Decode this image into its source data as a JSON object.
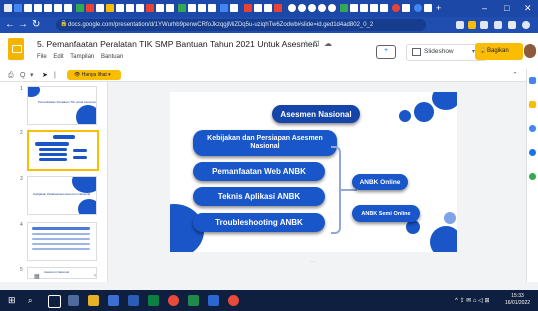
{
  "browser": {
    "url": "docs.google.com/presentation/d/1YWurhb9penwCRfoJkzqgjMiZDq5u-uziqhTw6Zodwb#slide=id.ged1d4ad802_0_2",
    "window_controls": [
      "–",
      "□",
      "✕"
    ],
    "new_tab": "+"
  },
  "header": {
    "title": "5. Pemanfaatan Peralatan TIK SMP Bantuan Tahun 2021 Untuk Asesmen",
    "menus": [
      "File",
      "Edit",
      "Tampilan",
      "Bantuan"
    ],
    "slideshow_label": "Slideshow",
    "share_label": "Bagikan"
  },
  "toolbar": {
    "zoom_label": "Q",
    "hide_menus_label": "Hanya lihat"
  },
  "filmstrip": {
    "slide_numbers": [
      "1",
      "2",
      "3",
      "4",
      "5"
    ],
    "thumb1_title": "Pemanfaatan Peralatan TIK untuk Asesmen",
    "thumb3_title": "Kebijakan Pelaksanaan Asesmen Nasional",
    "thumb5_title": "Asesmen Nasional"
  },
  "slide": {
    "title": "Asesmen Nasional",
    "items": [
      "Kebijakan dan Persiapan Asesmen Nasional",
      "Pemanfaatan Web ANBK",
      "Teknis Aplikasi ANBK",
      "Troubleshooting ANBK"
    ],
    "sub_items": [
      "ANBK Online",
      "ANBK Semi Online"
    ]
  },
  "taskbar": {
    "time": "15:33",
    "date": "16/01/2022",
    "tray": "^ ⇪ ✉ ⌂ ◁ ⊞"
  },
  "colors": {
    "browser_blue": "#1f4eb0",
    "slide_blue": "#1856c9",
    "accent_yellow": "#fbbc04"
  }
}
